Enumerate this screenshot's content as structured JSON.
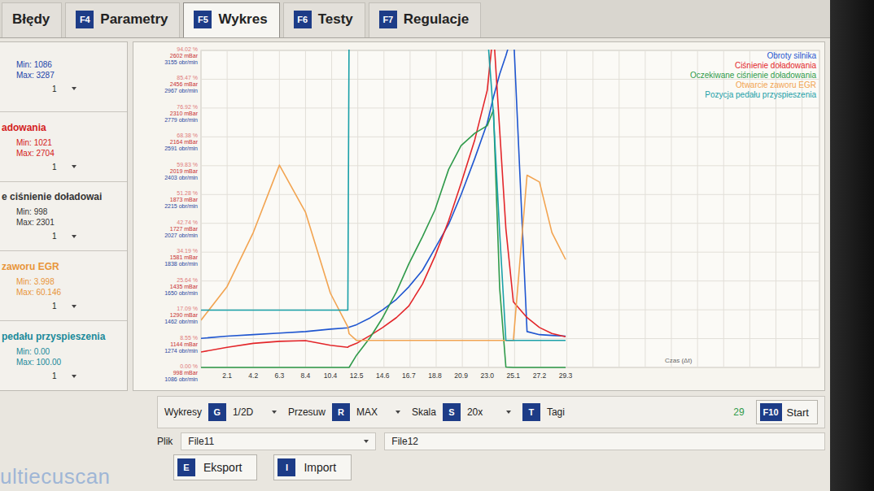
{
  "tabs": [
    {
      "label": "Błędy",
      "selected": false
    },
    {
      "key": "F4",
      "label": "Parametry",
      "selected": false
    },
    {
      "key": "F5",
      "label": "Wykres",
      "selected": true
    },
    {
      "key": "F6",
      "label": "Testy",
      "selected": false
    },
    {
      "key": "F7",
      "label": "Regulacje",
      "selected": false
    }
  ],
  "sidebar": {
    "sections": [
      {
        "min": "Min: 1086",
        "max": "Max: 3287",
        "select": "1",
        "color": "#2244aa"
      },
      {
        "title": "adowania",
        "min": "Min: 1021",
        "max": "Max: 2704",
        "select": "1",
        "color": "#d42020"
      },
      {
        "title": "e ciśnienie doładowai",
        "min": "Min: 998",
        "max": "Max: 2301",
        "select": "1",
        "color": "#333333"
      },
      {
        "title": "zaworu EGR",
        "min": "Min: 3.998",
        "max": "Max: 60.146",
        "select": "1",
        "color": "#e8953a"
      },
      {
        "title": "pedału przyspieszenia",
        "min": "Min: 0.00",
        "max": "Max: 100.00",
        "select": "1",
        "color": "#1a8a9a"
      }
    ]
  },
  "chart": {
    "y_ticks": [
      {
        "percent": "94.02 %",
        "pressure": "2602 mBar",
        "rpm": "3155 obr/min"
      },
      {
        "percent": "85.47 %",
        "pressure": "2456 mBar",
        "rpm": "2967 obr/min"
      },
      {
        "percent": "76.92 %",
        "pressure": "2310 mBar",
        "rpm": "2779 obr/min"
      },
      {
        "percent": "68.38 %",
        "pressure": "2164 mBar",
        "rpm": "2591 obr/min"
      },
      {
        "percent": "59.83 %",
        "pressure": "2019 mBar",
        "rpm": "2403 obr/min"
      },
      {
        "percent": "51.28 %",
        "pressure": "1873 mBar",
        "rpm": "2215 obr/min"
      },
      {
        "percent": "42.74 %",
        "pressure": "1727 mBar",
        "rpm": "2027 obr/min"
      },
      {
        "percent": "34.19 %",
        "pressure": "1581 mBar",
        "rpm": "1838 obr/min"
      },
      {
        "percent": "25.64 %",
        "pressure": "1435 mBar",
        "rpm": "1650 obr/min"
      },
      {
        "percent": "17.09 %",
        "pressure": "1290 mBar",
        "rpm": "1462 obr/min"
      },
      {
        "percent": "8.55 %",
        "pressure": "1144 mBar",
        "rpm": "1274 obr/min"
      },
      {
        "percent": "0.00 %",
        "pressure": "998 mBar",
        "rpm": "1086 obr/min"
      }
    ],
    "x_ticks": [
      "2.1",
      "4.2",
      "6.3",
      "8.4",
      "10.4",
      "12.5",
      "14.6",
      "16.7",
      "18.8",
      "20.9",
      "23.0",
      "25.1",
      "27.2",
      "29.3"
    ],
    "x_label": "Czas (Δt)",
    "time": [
      0,
      2.1,
      4.2,
      6.3,
      8.4,
      10.4,
      11.8,
      11.9,
      12.5,
      13.6,
      14.6,
      15.7,
      16.7,
      17.8,
      18.8,
      19.9,
      20.9,
      22.0,
      23.0,
      23.5,
      24.0,
      24.5,
      25.1,
      26.2,
      27.2,
      28.2,
      29.3
    ],
    "series": [
      {
        "name": "Obroty silnika",
        "axis": "rpm",
        "color": "#1f56d0",
        "values": [
          1276,
          1290,
          1300,
          1310,
          1320,
          1336,
          1345,
          1348,
          1365,
          1410,
          1462,
          1530,
          1612,
          1720,
          1862,
          2020,
          2213,
          2450,
          2680,
          2850,
          3000,
          3120,
          3287,
          1320,
          1300,
          1295,
          1290
        ]
      },
      {
        "name": "Ciśnienie doładowania",
        "axis": "pressure",
        "color": "#e3262a",
        "values": [
          1076,
          1100,
          1120,
          1130,
          1134,
          1110,
          1100,
          1105,
          1120,
          1160,
          1200,
          1250,
          1309,
          1420,
          1561,
          1740,
          1930,
          2150,
          2400,
          2704,
          2200,
          1700,
          1330,
          1250,
          1200,
          1170,
          1153
        ]
      },
      {
        "name": "Oczekiwane ciśnienie doładowania",
        "axis": "pressure",
        "color": "#2f9a4a",
        "values": [
          998,
          998,
          998,
          998,
          998,
          998,
          998,
          998,
          1060,
          1150,
          1250,
          1380,
          1522,
          1660,
          1795,
          2000,
          2120,
          2183,
          2221,
          2301,
          1400,
          1000,
          998,
          998,
          998,
          998,
          998
        ]
      },
      {
        "name": "Otwarcie zaworu EGR",
        "axis": "percent",
        "color": "#f2a451",
        "values": [
          14,
          24,
          40,
          60,
          46,
          22,
          12,
          10,
          8,
          8,
          8,
          8,
          8,
          8,
          8,
          8,
          8,
          8,
          8,
          8,
          8,
          8,
          8,
          57,
          55,
          40,
          32
        ]
      },
      {
        "name": "Pozycja pedału przyspieszenia",
        "axis": "percent",
        "color": "#1aa0a8",
        "values": [
          17,
          17,
          17,
          17,
          17,
          17,
          17,
          100,
          100,
          100,
          100,
          100,
          100,
          100,
          100,
          100,
          100,
          100,
          100,
          75,
          40,
          8,
          8,
          8,
          8,
          8,
          8
        ]
      }
    ]
  },
  "toolbar": {
    "controls": [
      {
        "kind": "select",
        "label": "Wykresy",
        "key": "G",
        "value": "1/2D"
      },
      {
        "kind": "select",
        "label": "Przesuw",
        "key": "R",
        "value": "MAX"
      },
      {
        "kind": "select",
        "label": "Skala",
        "key": "S",
        "value": "20x"
      },
      {
        "kind": "toggle",
        "label": "Tagi",
        "key": "T"
      }
    ],
    "counter": "29",
    "start": {
      "key": "F10",
      "label": "Start"
    },
    "file": {
      "label": "Plik",
      "value": "File11"
    },
    "file2": "File12",
    "buttons": [
      {
        "key": "E",
        "label": "Eksport"
      },
      {
        "key": "I",
        "label": "Import"
      }
    ]
  },
  "logo": "ultiecuscan"
}
